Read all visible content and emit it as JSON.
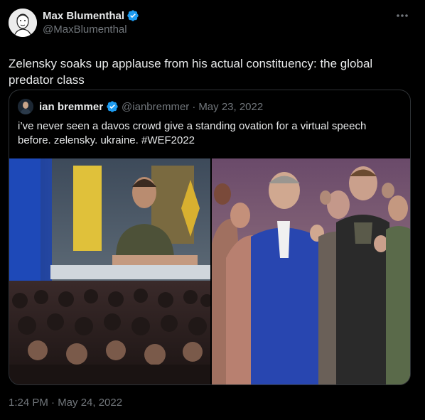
{
  "author": {
    "name": "Max Blumenthal",
    "handle": "@MaxBlumenthal",
    "verified": true
  },
  "tweet": {
    "text": "Zelensky soaks up applause from his actual constituency: the global predator class",
    "timestamp": "1:24 PM · May 24, 2022"
  },
  "quoted": {
    "name": "ian bremmer",
    "handle": "@ianbremmer",
    "separator": "·",
    "date": "May 23, 2022",
    "text": "i’ve never seen a davos crowd give a standing ovation for a virtual speech before. zelensky. ukraine. #WEF2022"
  },
  "icons": {
    "verified": "verified-badge-icon",
    "more": "more-options-icon"
  },
  "colors": {
    "background": "#000000",
    "primary_text": "#e7e9ea",
    "secondary_text": "#71767b",
    "border": "#2f3336",
    "verified_blue": "#1d9bf0"
  }
}
